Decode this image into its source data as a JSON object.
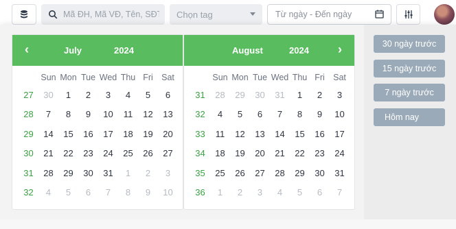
{
  "toolbar": {
    "search_placeholder": "Mã ĐH, Mã VĐ, Tên, SĐT k",
    "tag_placeholder": "Chọn tag",
    "date_placeholder": "Từ ngày - Đến ngày"
  },
  "accent_color": "#59bc5e",
  "weekdays": [
    "Sun",
    "Mon",
    "Tue",
    "Wed",
    "Thu",
    "Fri",
    "Sat"
  ],
  "calendars": [
    {
      "month": "July",
      "year": "2024",
      "weeks": [
        {
          "num": "27",
          "days": [
            {
              "d": "30",
              "muted": true
            },
            {
              "d": "1"
            },
            {
              "d": "2"
            },
            {
              "d": "3"
            },
            {
              "d": "4"
            },
            {
              "d": "5"
            },
            {
              "d": "6"
            }
          ]
        },
        {
          "num": "28",
          "days": [
            {
              "d": "7"
            },
            {
              "d": "8"
            },
            {
              "d": "9"
            },
            {
              "d": "10"
            },
            {
              "d": "11"
            },
            {
              "d": "12"
            },
            {
              "d": "13"
            }
          ]
        },
        {
          "num": "29",
          "days": [
            {
              "d": "14"
            },
            {
              "d": "15"
            },
            {
              "d": "16"
            },
            {
              "d": "17"
            },
            {
              "d": "18"
            },
            {
              "d": "19"
            },
            {
              "d": "20"
            }
          ]
        },
        {
          "num": "30",
          "days": [
            {
              "d": "21"
            },
            {
              "d": "22"
            },
            {
              "d": "23"
            },
            {
              "d": "24"
            },
            {
              "d": "25"
            },
            {
              "d": "26"
            },
            {
              "d": "27"
            }
          ]
        },
        {
          "num": "31",
          "days": [
            {
              "d": "28"
            },
            {
              "d": "29"
            },
            {
              "d": "30"
            },
            {
              "d": "31"
            },
            {
              "d": "1",
              "muted": true
            },
            {
              "d": "2",
              "muted": true
            },
            {
              "d": "3",
              "muted": true
            }
          ]
        },
        {
          "num": "32",
          "days": [
            {
              "d": "4",
              "muted": true
            },
            {
              "d": "5",
              "muted": true
            },
            {
              "d": "6",
              "muted": true
            },
            {
              "d": "7",
              "muted": true
            },
            {
              "d": "8",
              "muted": true
            },
            {
              "d": "9",
              "muted": true
            },
            {
              "d": "10",
              "muted": true
            }
          ]
        }
      ]
    },
    {
      "month": "August",
      "year": "2024",
      "weeks": [
        {
          "num": "31",
          "days": [
            {
              "d": "28",
              "muted": true
            },
            {
              "d": "29",
              "muted": true
            },
            {
              "d": "30",
              "muted": true
            },
            {
              "d": "31",
              "muted": true
            },
            {
              "d": "1"
            },
            {
              "d": "2"
            },
            {
              "d": "3"
            }
          ]
        },
        {
          "num": "32",
          "days": [
            {
              "d": "4"
            },
            {
              "d": "5"
            },
            {
              "d": "6"
            },
            {
              "d": "7"
            },
            {
              "d": "8"
            },
            {
              "d": "9"
            },
            {
              "d": "10"
            }
          ]
        },
        {
          "num": "33",
          "days": [
            {
              "d": "11"
            },
            {
              "d": "12"
            },
            {
              "d": "13"
            },
            {
              "d": "14"
            },
            {
              "d": "15"
            },
            {
              "d": "16"
            },
            {
              "d": "17"
            }
          ]
        },
        {
          "num": "34",
          "days": [
            {
              "d": "18"
            },
            {
              "d": "19"
            },
            {
              "d": "20"
            },
            {
              "d": "21"
            },
            {
              "d": "22"
            },
            {
              "d": "23"
            },
            {
              "d": "24"
            }
          ]
        },
        {
          "num": "35",
          "days": [
            {
              "d": "25"
            },
            {
              "d": "26"
            },
            {
              "d": "27"
            },
            {
              "d": "28"
            },
            {
              "d": "29"
            },
            {
              "d": "30"
            },
            {
              "d": "31"
            }
          ]
        },
        {
          "num": "36",
          "days": [
            {
              "d": "1",
              "muted": true
            },
            {
              "d": "2",
              "muted": true
            },
            {
              "d": "3",
              "muted": true
            },
            {
              "d": "4",
              "muted": true
            },
            {
              "d": "5",
              "muted": true
            },
            {
              "d": "6",
              "muted": true
            },
            {
              "d": "7",
              "muted": true
            }
          ]
        }
      ]
    }
  ],
  "presets": [
    "30 ngày trước",
    "15 ngày trước",
    "7 ngày trước",
    "Hôm nay"
  ]
}
